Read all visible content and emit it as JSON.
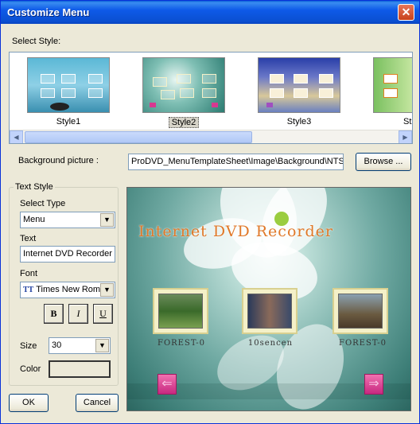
{
  "window": {
    "title": "Customize Menu",
    "close_glyph": "✕"
  },
  "select_style": {
    "label": "Select Style:",
    "items": [
      {
        "label": "Style1",
        "selected": false
      },
      {
        "label": "Style2",
        "selected": true
      },
      {
        "label": "Style3",
        "selected": false
      },
      {
        "label": "St",
        "selected": false
      }
    ]
  },
  "background": {
    "label": "Background picture :",
    "path": "ProDVD_MenuTemplateSheet\\Image\\Background\\NTS",
    "browse_label": "Browse ..."
  },
  "text_style": {
    "group_label": "Text Style",
    "select_type_label": "Select Type",
    "select_type_value": "Menu",
    "text_label": "Text",
    "text_value": "Internet DVD Recorder",
    "font_label": "Font",
    "font_icon": "TT",
    "font_value": "Times New Roma",
    "bold": "B",
    "italic": "I",
    "underline": "U",
    "size_label": "Size",
    "size_value": "30",
    "color_label": "Color"
  },
  "preview": {
    "title": "Internet DVD Recorder",
    "captions": [
      "FOREST-0",
      "10sencen",
      "FOREST-0"
    ],
    "prev_glyph": "⇐",
    "next_glyph": "⇒"
  },
  "footer": {
    "ok_label": "OK",
    "cancel_label": "Cancel"
  },
  "colors": {
    "titlebar": "#0a4fd0",
    "dialog": "#ece9d8",
    "preview_title": "#e07828",
    "nav_arrow": "#d83890"
  }
}
